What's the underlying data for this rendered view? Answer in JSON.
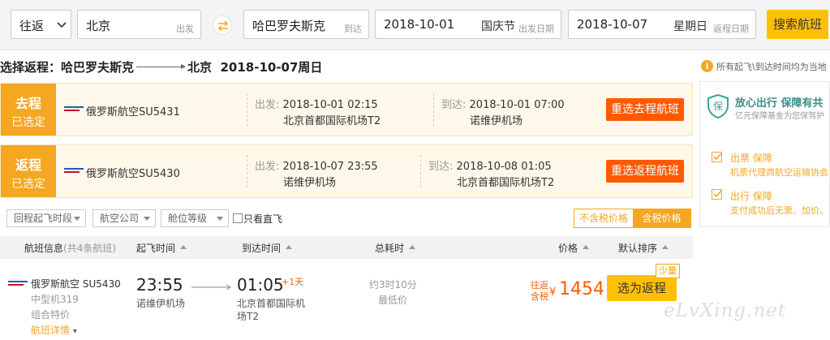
{
  "search": {
    "trip_type": "往返",
    "from_city": "北京",
    "from_hint": "出发",
    "to_city": "哈巴罗夫斯克",
    "to_hint": "到达",
    "depart_date": "2018-10-01",
    "depart_holiday": "国庆节",
    "depart_hint": "出发日期",
    "return_date": "2018-10-07",
    "return_weekday": "星期日",
    "return_hint": "返程日期",
    "search_button": "搜索航班"
  },
  "page_title": {
    "prefix": "选择返程：哈巴罗夫斯克",
    "dest": "北京",
    "date": "2018-10-07周日"
  },
  "selected": [
    {
      "tag_title": "去程",
      "tag_sub": "已选定",
      "airline": "俄罗斯航空SU5431",
      "dep_label": "出发:",
      "dep_time": "2018-10-01 02:15",
      "dep_airport": "北京首都国际机场T2",
      "arr_label": "到达:",
      "arr_time": "2018-10-01 07:00",
      "arr_airport": "诺维伊机场",
      "button": "重选去程航班"
    },
    {
      "tag_title": "返程",
      "tag_sub": "已选定",
      "airline": "俄罗斯航空SU5430",
      "dep_label": "出发:",
      "dep_time": "2018-10-07 23:55",
      "dep_airport": "诺维伊机场",
      "arr_label": "到达:",
      "arr_time": "2018-10-08 01:05",
      "arr_airport": "北京首都国际机场T2",
      "button": "重选返程航班"
    }
  ],
  "filters": {
    "dep_time": "回程起飞时段",
    "airline": "航空公司",
    "cabin": "舱位等级",
    "direct_only": "只看直飞",
    "price_excl": "不含税价格",
    "price_incl": "含税价格"
  },
  "list_header": {
    "info": "航班信息",
    "info_count": "(共4条航班)",
    "dep": "起飞时间",
    "arr": "到达时间",
    "duration": "总耗时",
    "price": "价格",
    "sort": "默认排序"
  },
  "flight": {
    "airline": "俄罗斯航空",
    "flight_no": "SU5430",
    "aircraft": "中型机319",
    "group": "组合特价",
    "details": "航班详情",
    "dep_time": "23:55",
    "dep_airport": "诺维伊机场",
    "arr_time": "01:05",
    "arr_plus": "+1天",
    "arr_airport_line1": "北京首都国际机",
    "arr_airport_line2": "场T2",
    "duration": "约3时10分",
    "duration_note": "最低价",
    "price_note_1": "往返",
    "price_note_2": "含税",
    "currency": "¥",
    "price": "1454",
    "select_button": "选为返程",
    "few_badge": "少量"
  },
  "sidebar": {
    "notice": "所有起飞\\到达时间均为当地",
    "guarantee_title": "放心出行 保障有共",
    "guarantee_sub": "亿元保障基金为您保驾护",
    "item1_title": "出票 保障",
    "item1_desc": "机票代理商航空运输协会",
    "item2_title": "出行 保障",
    "item2_desc": "支付成功后无票、加价、"
  },
  "watermark": "eLvXing.net",
  "colors": {
    "accent": "#f5a623",
    "cta": "#ffc107",
    "danger": "#ff5a00"
  },
  "icons": [
    "chevron-down-icon",
    "swap-arrows-icon",
    "airline-logo-icon",
    "shield-icon",
    "check-icon",
    "info-icon",
    "sort-up-icon"
  ]
}
